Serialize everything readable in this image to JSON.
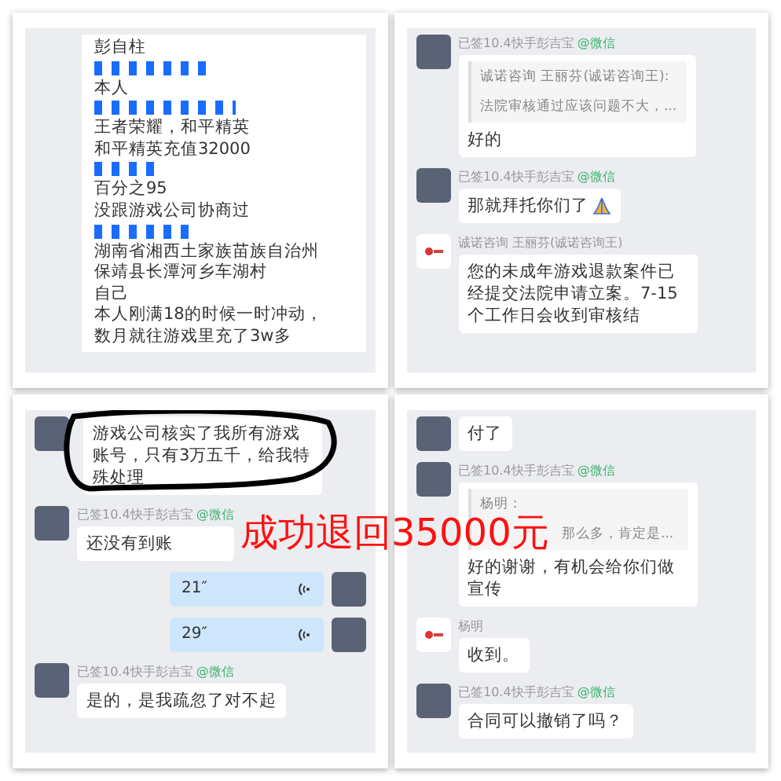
{
  "panels": [
    {
      "messages": [
        {
          "kind": "list",
          "lines": [
            {
              "kind": "text",
              "text": "彭自柱"
            },
            {
              "kind": "redacted"
            },
            {
              "kind": "text",
              "text": "本人"
            },
            {
              "kind": "redacted"
            },
            {
              "kind": "text",
              "text": "王者荣耀，和平精英"
            },
            {
              "kind": "text",
              "text": "和平精英充值32000"
            },
            {
              "kind": "redacted"
            },
            {
              "kind": "text",
              "text": "百分之95"
            },
            {
              "kind": "text",
              "text": "没跟游戏公司协商过"
            },
            {
              "kind": "redacted"
            },
            {
              "kind": "text",
              "text": "湖南省湘西土家族苗族自治州"
            },
            {
              "kind": "text",
              "text": "保靖县长潭河乡车湖村"
            },
            {
              "kind": "text",
              "text": "自己"
            },
            {
              "kind": "text",
              "text": "本人刚满18的时候一时冲动，"
            },
            {
              "kind": "text",
              "text": "数月就往游戏里充了3w多"
            }
          ]
        }
      ]
    },
    {
      "messages": [
        {
          "kind": "quote",
          "avatar": {
            "kind": "photo"
          },
          "name": "已签10.4快手彭吉宝",
          "tag": "@微信",
          "quote_author": "诚诺咨询 王丽芬(诚诺咨询王):",
          "quote_text": "法院审核通过应该问题不大，...",
          "text": "好的"
        },
        {
          "kind": "text",
          "avatar": {
            "kind": "photo"
          },
          "name": "已签10.4快手彭吉宝",
          "tag": "@微信",
          "text": "那就拜托你们了",
          "praying_hands": true
        },
        {
          "kind": "text",
          "avatar": {
            "kind": "logo"
          },
          "name": "诚诺咨询 王丽芬(诚诺咨询王)",
          "text": "您的未成年游戏退款案件已经提交法院申请立案。7-15个工作日会收到审核结"
        }
      ]
    },
    {
      "messages": [
        {
          "kind": "text",
          "avatar": {
            "kind": "photo"
          },
          "text": "游戏公司核实了我所有游戏账号，只有3万五千，给我特殊处理",
          "circled": true
        },
        {
          "kind": "text",
          "avatar": {
            "kind": "photo"
          },
          "name": "已签10.4快手彭吉宝",
          "tag": "@微信",
          "text": "还没有到账"
        },
        {
          "kind": "voice",
          "avatar": {
            "kind": "photo"
          },
          "text": "21″"
        },
        {
          "kind": "voice",
          "avatar": {
            "kind": "photo"
          },
          "text": "29″"
        },
        {
          "kind": "text",
          "avatar": {
            "kind": "photo"
          },
          "name": "已签10.4快手彭吉宝",
          "tag": "@微信",
          "text": "是的，是我疏忽了对不起"
        }
      ]
    },
    {
      "messages": [
        {
          "kind": "text",
          "avatar": {
            "kind": "photo"
          },
          "text": "付了"
        },
        {
          "kind": "quote",
          "avatar": {
            "kind": "photo"
          },
          "name": "已签10.4快手彭吉宝",
          "tag": "@微信",
          "quote_author": "杨明：",
          "quote_text": "那么多，肯定是...",
          "text": "好的谢谢，有机会给你们做宣传"
        },
        {
          "kind": "text",
          "avatar": {
            "kind": "logo"
          },
          "name": "杨明",
          "text": "收到。"
        },
        {
          "kind": "text",
          "avatar": {
            "kind": "photo"
          },
          "name": "已签10.4快手彭吉宝",
          "tag": "@微信",
          "text": "合同可以撤销了吗？"
        }
      ]
    }
  ],
  "overlay_caption": "成功退回35000元"
}
